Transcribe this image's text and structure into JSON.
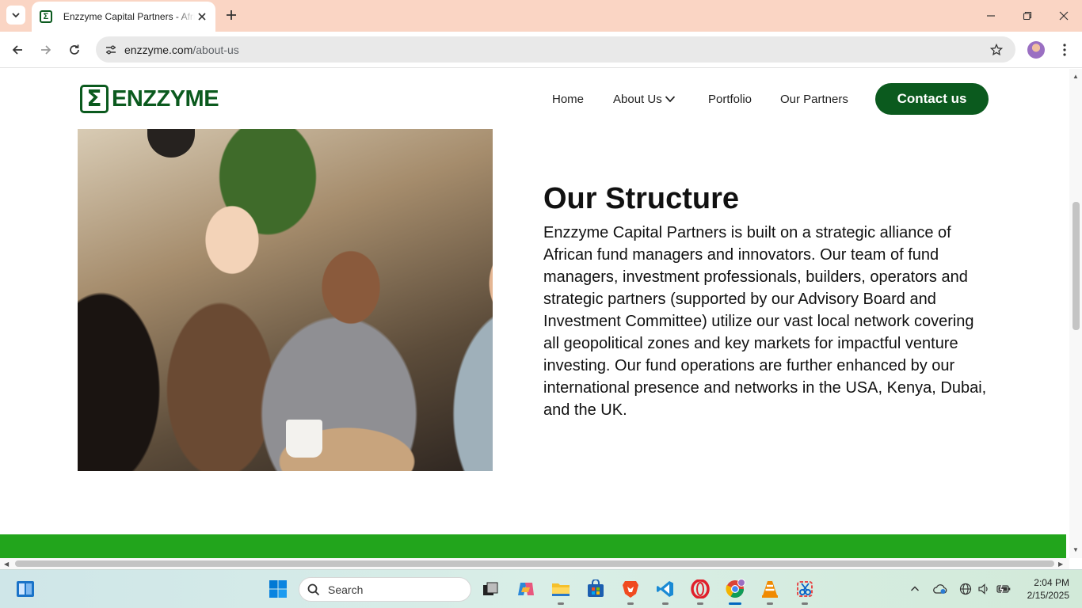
{
  "browser": {
    "tab_title": "Enzzyme Capital Partners - African Fund Managers",
    "favicon_letter": "Σ",
    "url_host": "enzzyme.com",
    "url_path": "/about-us"
  },
  "site": {
    "logo_mark": "Σ",
    "logo_text": "ENZZYME",
    "nav": [
      "Home",
      "About Us",
      "Portfolio",
      "Our Partners"
    ],
    "cta": "Contact us",
    "brand_color": "#0b5a1e",
    "band_color": "#22a51c"
  },
  "section": {
    "title": "Our Structure",
    "body": "Enzzyme Capital Partners is built on a strategic alliance of African fund managers and innovators. Our team of fund managers, investment professionals, builders, operators and strategic partners (supported by our Advisory Board and Investment Committee) utilize our vast local network covering all geopolitical zones and key markets for impactful venture investing. Our fund operations are further enhanced by our international presence and networks in the USA, Kenya, Dubai, and the UK."
  },
  "taskbar": {
    "search_placeholder": "Search",
    "time": "2:04 PM",
    "date": "2/15/2025"
  }
}
